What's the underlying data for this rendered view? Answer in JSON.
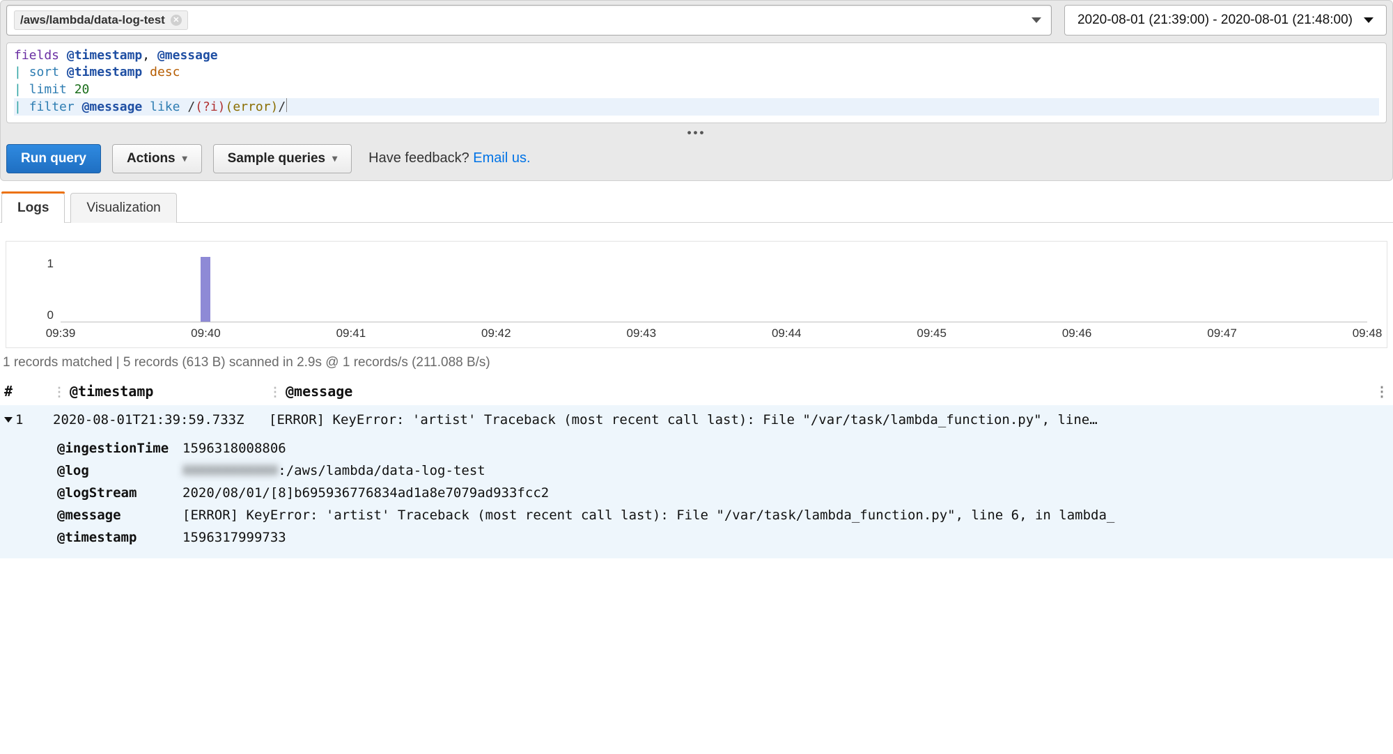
{
  "logGroup": {
    "selected": "/aws/lambda/data-log-test"
  },
  "timeRange": {
    "display": "2020-08-01 (21:39:00) - 2020-08-01 (21:48:00)"
  },
  "query": {
    "line1": {
      "fields_kw": "fields",
      "f1": "@timestamp",
      "comma": ", ",
      "f2": "@message"
    },
    "line2": {
      "pipe": "|",
      "sort_kw": "sort",
      "field": "@timestamp",
      "dir": "desc"
    },
    "line3": {
      "pipe": "|",
      "limit_kw": "limit",
      "n": "20"
    },
    "line4": {
      "pipe": "|",
      "filter_kw": "filter",
      "field": "@message",
      "like_kw": "like",
      "slash1": "/",
      "flag": "(?i)",
      "group": "(error)",
      "slash2": "/"
    }
  },
  "buttons": {
    "run": "Run query",
    "actions": "Actions",
    "sample": "Sample queries"
  },
  "feedback": {
    "prefix": "Have feedback? ",
    "link": "Email us."
  },
  "tabs": {
    "logs": "Logs",
    "viz": "Visualization"
  },
  "chart_data": {
    "type": "bar",
    "xlabel": "",
    "ylabel": "",
    "ylim": [
      0,
      1
    ],
    "yticks": [
      0,
      1
    ],
    "categories": [
      "09:39",
      "09:40",
      "09:41",
      "09:42",
      "09:43",
      "09:44",
      "09:45",
      "09:46",
      "09:47",
      "09:48"
    ],
    "values": [
      0,
      1,
      0,
      0,
      0,
      0,
      0,
      0,
      0,
      0
    ]
  },
  "summary": "1 records matched | 5 records (613 B) scanned in 2.9s @ 1 records/s (211.088 B/s)",
  "columns": {
    "idx": "#",
    "ts": "@timestamp",
    "msg": "@message"
  },
  "row": {
    "idx": "1",
    "timestamp": "2020-08-01T21:39:59.733Z",
    "message_short": "[ERROR] KeyError: 'artist' Traceback (most recent call last):   File \"/var/task/lambda_function.py\", line…",
    "details": {
      "ingestionTime_k": "@ingestionTime",
      "ingestionTime_v": "1596318008806",
      "log_k": "@log",
      "log_v_masked": "XXXXXXXXXXXX",
      "log_v_suffix": ":/aws/lambda/data-log-test",
      "logStream_k": "@logStream",
      "logStream_v": "2020/08/01/[8]b695936776834ad1a8e7079ad933fcc2",
      "message_k": "@message",
      "message_v": "[ERROR] KeyError: 'artist' Traceback (most recent call last):   File \"/var/task/lambda_function.py\", line 6, in lambda_",
      "timestamp_k": "@timestamp",
      "timestamp_v": "1596317999733"
    }
  }
}
